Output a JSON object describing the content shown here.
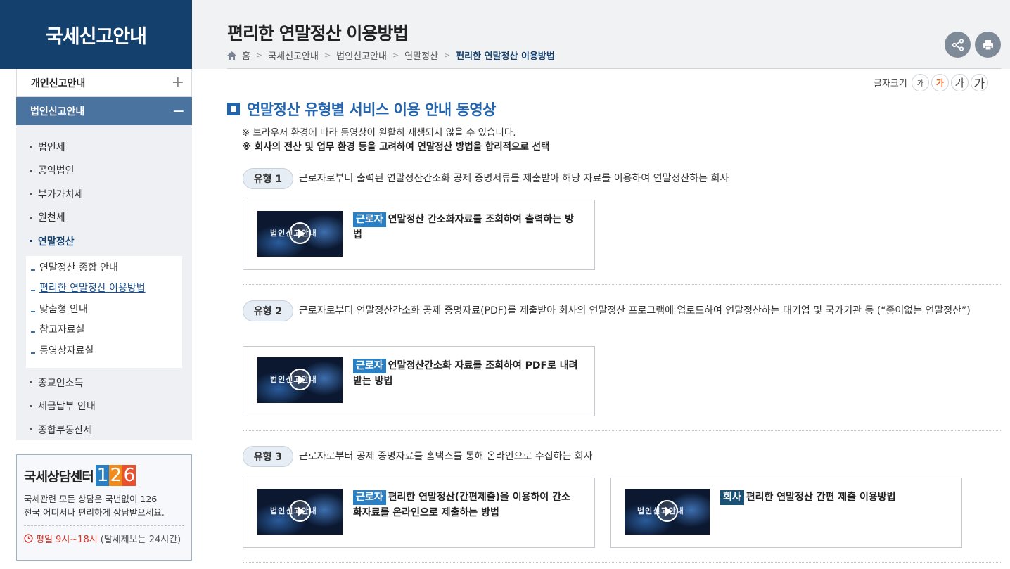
{
  "sidebar": {
    "title": "국세신고안내",
    "items": [
      {
        "label": "개인신고안내",
        "toggle": "+"
      },
      {
        "label": "법인신고안내",
        "toggle": "−"
      }
    ],
    "sub_items": [
      "법인세",
      "공익법인",
      "부가가치세",
      "원천세",
      "연말정산"
    ],
    "subsub_items": [
      "연말정산 종합 안내",
      "편리한 연말정산 이용방법",
      "맞춤형 안내",
      "참고자료실",
      "동영상자료실"
    ],
    "sub_items_after": [
      "종교인소득",
      "세금납부 안내",
      "종합부동산세"
    ]
  },
  "counsel": {
    "title": "국세상담센터",
    "digits": [
      "1",
      "2",
      "6"
    ],
    "desc_line1": "국세관련 모든 상담은 국번없이 126",
    "desc_line2": "전국 어디서나 편리하게 상담받으세요.",
    "time_red": "평일 9시~18시",
    "time_rest": "(탈세제보는 24시간)"
  },
  "header": {
    "title": "편리한 연말정산 이용방법",
    "breadcrumb": [
      "홈",
      "국세신고안내",
      "법인신고안내",
      "연말정산",
      "편리한 연말정산 이용방법"
    ]
  },
  "fontsize": {
    "label": "글자크기",
    "buttons": [
      "가",
      "가",
      "가",
      "가"
    ]
  },
  "main": {
    "section_title": "연말정산 유형별 서비스 이용 안내 동영상",
    "note1": "※ 브라우저 환경에 따라 동영상이 원활히 재생되지 않을 수 있습니다.",
    "note2": "※ 회사의 전산 및 업무 환경 등을 고려하여 연말정산 방법을 합리적으로 선택",
    "types": [
      {
        "pill": "유형 1",
        "desc": "근로자로부터 출력된 연말정산간소화 공제 증명서류를 제출받아 해당 자료를 이용하여 연말정산하는 회사"
      },
      {
        "pill": "유형 2",
        "desc": "근로자로부터 연말정산간소화 공제 증명자료(PDF)를 제출받아 회사의 연말정산 프로그램에 업로드하여 연말정산하는 대기업 및 국가기관 등 (“종이없는 연말정산”)"
      },
      {
        "pill": "유형 3",
        "desc": "근로자로부터 공제 증명자료를 홈택스를 통해 온라인으로 수집하는 회사"
      }
    ],
    "videos": [
      {
        "badge": "근로자",
        "text": "연말정산 간소화자료를 조회하여 출력하는 방법",
        "thumb_title": "법인신고안내"
      },
      {
        "badge": "근로자",
        "text": "연말정산간소화 자료를 조회하여 PDF로 내려받는 방법",
        "thumb_title": "법인신고안내"
      },
      {
        "badge": "근로자",
        "text": "편리한 연말정산(간편제출)을 이용하여 간소화자료를 온라인으로 제출하는 방법",
        "thumb_title": "법인신고안내"
      },
      {
        "badge": "회사",
        "text": "편리한 연말정산 간편 제출 이용방법",
        "thumb_title": "법인신고안내"
      }
    ]
  },
  "colors": {
    "navy": "#14406e",
    "accent_blue": "#2364ae",
    "badge_worker": "#2a80c4",
    "badge_company": "#1a5276",
    "digit_colors": [
      "#2a80c4",
      "#f08c1e",
      "#e8502e"
    ]
  }
}
